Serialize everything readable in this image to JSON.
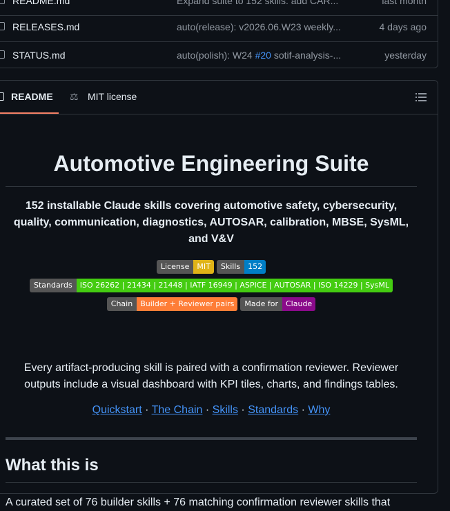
{
  "files": [
    {
      "name": "README.md",
      "message": "Expand suite to 152 skills: add CAR...",
      "pr": "",
      "message_after": "",
      "time": "last month"
    },
    {
      "name": "RELEASES.md",
      "message": "auto(release): v2026.06.W23 weekly...",
      "pr": "",
      "message_after": "",
      "time": "4 days ago"
    },
    {
      "name": "STATUS.md",
      "message": "auto(polish): W24 ",
      "pr": "#20",
      "message_after": " sotif-analysis-...",
      "time": "yesterday"
    }
  ],
  "tabs": {
    "readme": "README",
    "license": "MIT license"
  },
  "readme": {
    "title": "Automotive Engineering Suite",
    "subtitle": "152 installable Claude skills covering automotive safety, cybersecurity, quality, communication, diagnostics, AUTOSAR, calibration, MBSE, SysML, and V&V",
    "badges": [
      [
        {
          "label": "License",
          "value": "MIT",
          "color": "#dfb317"
        },
        {
          "label": "Skills",
          "value": "152",
          "color": "#007ec6"
        }
      ],
      [
        {
          "label": "Standards",
          "value": "ISO 26262 | 21434 | 21448 | IATF 16949 | ASPICE | AUTOSAR | ISO 14229 | SysML",
          "color": "#4c1"
        }
      ],
      [
        {
          "label": "Chain",
          "value": "Builder + Reviewer pairs",
          "color": "#fe7d37"
        },
        {
          "label": "Made for",
          "value": "Claude",
          "color": "#8a0a8a"
        }
      ]
    ],
    "paragraph": "Every artifact-producing skill is paired with a confirmation reviewer. Reviewer outputs include a visual dashboard with KPI tiles, charts, and findings tables.",
    "links": [
      "Quickstart",
      "The Chain",
      "Skills",
      "Standards",
      "Why"
    ],
    "link_separator": " · ",
    "section_heading": "What this is",
    "intro": "A curated set of 76 builder skills + 76 matching confirmation reviewer skills that"
  },
  "colors": {
    "background": "#0d1117",
    "border": "#30363d",
    "link": "#4493f8",
    "tab_underline": "#f78166",
    "muted": "#9198a1"
  }
}
